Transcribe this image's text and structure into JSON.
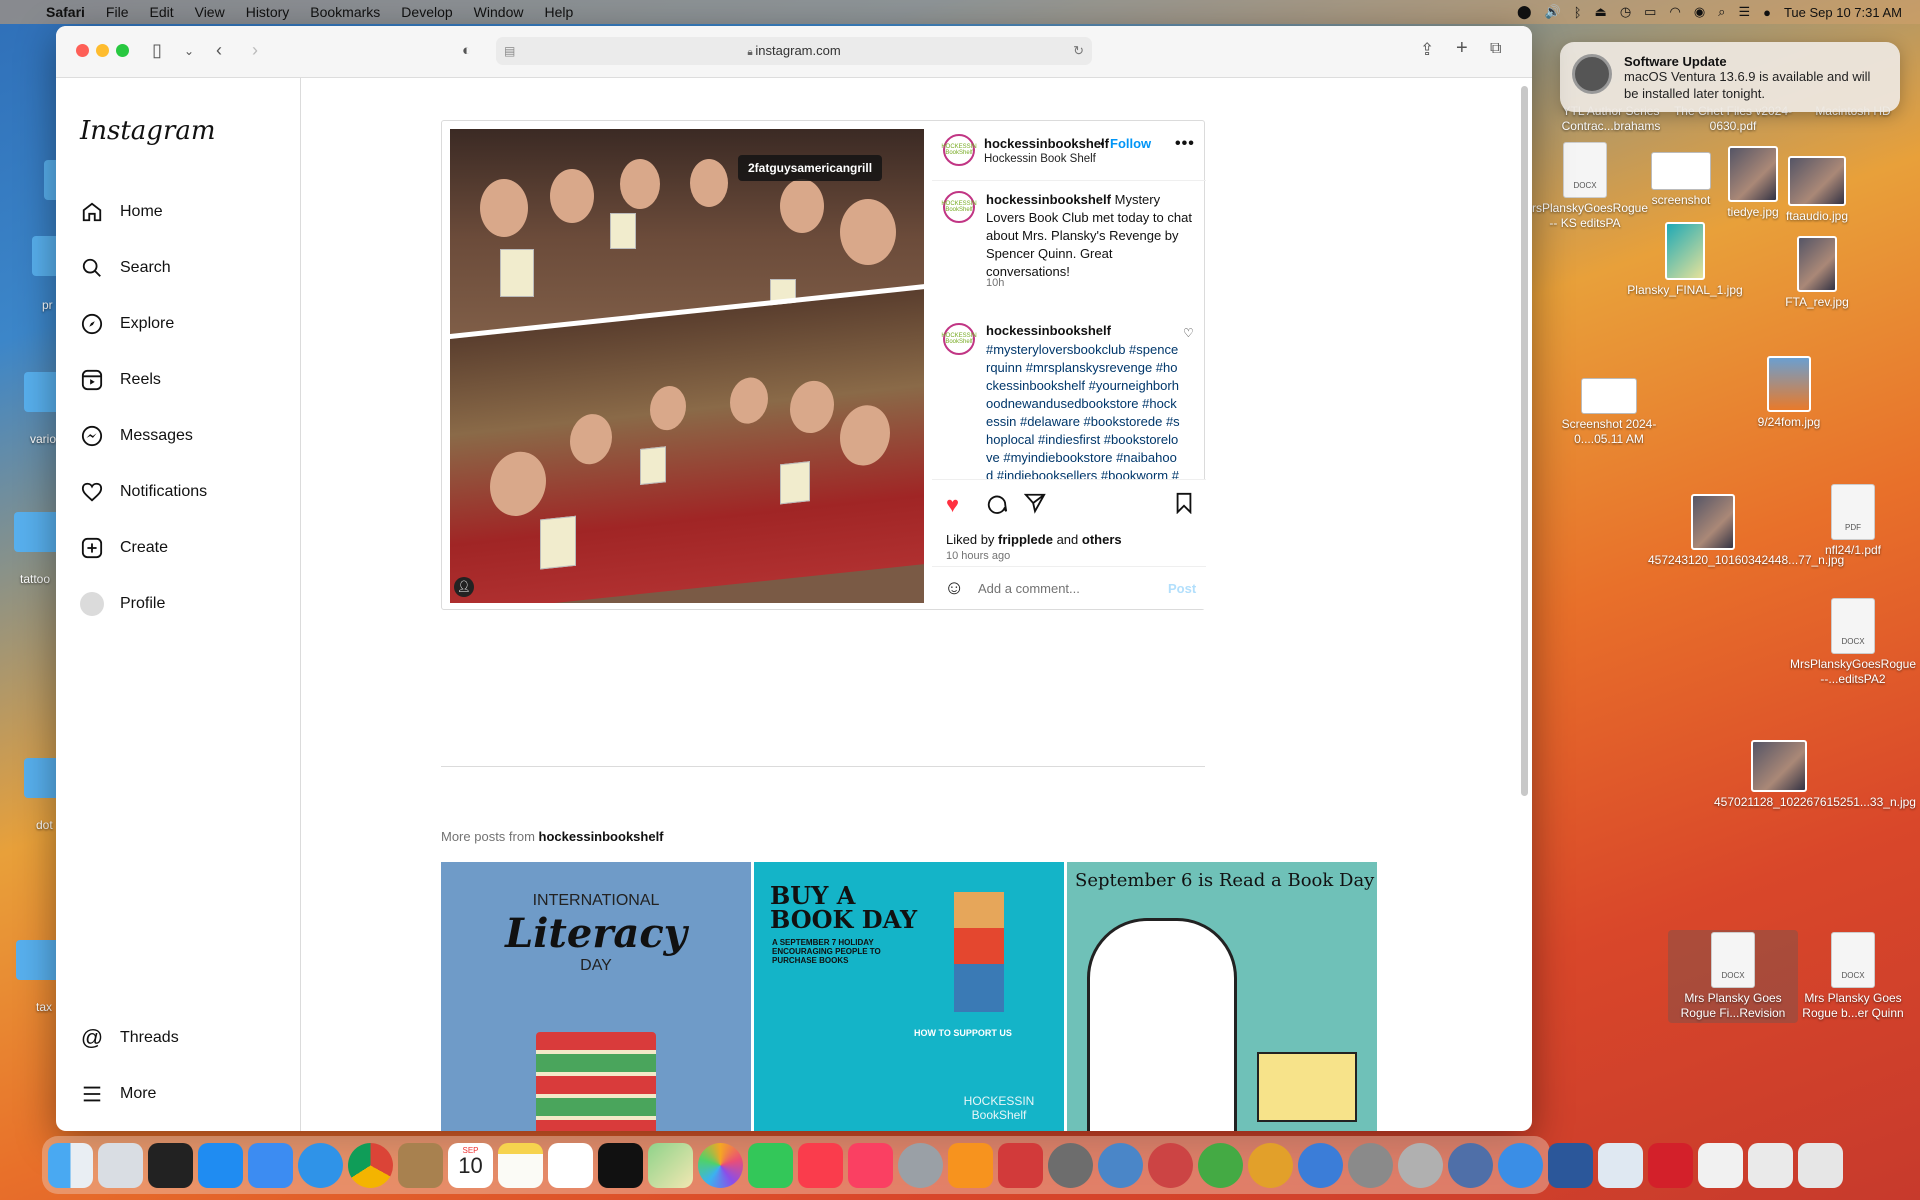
{
  "menubar": {
    "app": "Safari",
    "items": [
      "File",
      "Edit",
      "View",
      "History",
      "Bookmarks",
      "Develop",
      "Window",
      "Help"
    ],
    "datetime": "Tue Sep 10  7:31 AM"
  },
  "notification": {
    "title": "Software Update",
    "body": "macOS Ventura 13.6.9 is available and will be installed later tonight."
  },
  "desktop": {
    "left_labels": [
      "pr",
      "vario",
      "tattoo",
      "dot",
      "tax"
    ],
    "icons": [
      {
        "label": "YTL Author Series Contrac...brahams",
        "kind": "doc"
      },
      {
        "label": "The Chet Files v2024-0630.pdf",
        "kind": "doc"
      },
      {
        "label": "Macintosh HD",
        "kind": "doc"
      },
      {
        "label": "MrsPlanskyGoesRogue -- KS editsPA",
        "kind": "docx",
        "badge": "DOCX"
      },
      {
        "label": "screenshot",
        "kind": "shot"
      },
      {
        "label": "tiedye.jpg",
        "kind": "img"
      },
      {
        "label": "ftaaudio.jpg",
        "kind": "img"
      },
      {
        "label": "Plansky_FINAL_1.jpg",
        "kind": "img"
      },
      {
        "label": "FTA_rev.jpg",
        "kind": "img"
      },
      {
        "label": "Screenshot 2024-0....05.11 AM",
        "kind": "shot"
      },
      {
        "label": "9/24fom.jpg",
        "kind": "img"
      },
      {
        "label": "457243120_10160342448...77_n.jpg",
        "kind": "img"
      },
      {
        "label": "nfl24/1.pdf",
        "kind": "pdf",
        "badge": "PDF"
      },
      {
        "label": "MrsPlanskyGoesRogue --...editsPA2",
        "kind": "docx",
        "badge": "DOCX"
      },
      {
        "label": "457021128_102267615251...33_n.jpg",
        "kind": "img"
      },
      {
        "label": "Mrs Plansky Goes Rogue Fi...Revision",
        "kind": "docx",
        "badge": "DOCX"
      },
      {
        "label": "Mrs Plansky Goes Rogue b...er Quinn",
        "kind": "docx",
        "badge": "DOCX"
      }
    ]
  },
  "browser": {
    "url": "instagram.com"
  },
  "sidebar": {
    "logo": "Instagram",
    "items": [
      {
        "label": "Home",
        "icon": "home-icon"
      },
      {
        "label": "Search",
        "icon": "search-icon"
      },
      {
        "label": "Explore",
        "icon": "compass-icon"
      },
      {
        "label": "Reels",
        "icon": "reels-icon"
      },
      {
        "label": "Messages",
        "icon": "messenger-icon"
      },
      {
        "label": "Notifications",
        "icon": "heart-icon"
      },
      {
        "label": "Create",
        "icon": "plus-square-icon"
      },
      {
        "label": "Profile",
        "icon": "avatar-icon"
      }
    ],
    "bottom": [
      {
        "label": "Threads",
        "icon": "threads-icon"
      },
      {
        "label": "More",
        "icon": "menu-icon"
      }
    ]
  },
  "post": {
    "photo_tag": "2fatguysamericangrill",
    "username": "hockessinbookshelf",
    "follow": "Follow",
    "subtitle": "Hockessin Book Shelf",
    "avatar_text": "HOCKESSIN BookShelf",
    "caption": "Mystery Lovers Book Club met today to chat about Mrs. Plansky's Revenge by Spencer Quinn. Great conversations!",
    "caption_time": "10h",
    "comment_user": "hockessinbookshelf",
    "hashtags": "#mysteryloversbookclub #spencerquinn #mrsplanskysrevenge #hockessinbookshelf #yourneighborhoodnewandusedbookstore #hockessin #delaware #bookstorede #shoplocal #indiesfirst #bookstorelove #myindiebookstore #naibahood #indiebooksellers #bookworm #booknerd #bookaddict #supportlocalbookstores",
    "liked_by_prefix": "Liked by ",
    "liked_by_user": "fripplede",
    "liked_by_mid": " and ",
    "liked_by_others": "others",
    "time_ago": "10 hours ago",
    "comment_placeholder": "Add a comment...",
    "post_button": "Post"
  },
  "more_posts": {
    "prefix": "More posts from ",
    "user": "hockessinbookshelf",
    "tiles": [
      {
        "l1": "INTERNATIONAL",
        "l2": "Literacy",
        "l3": "DAY",
        "bg": "#6f9bc8"
      },
      {
        "l1": "BUY A BOOK DAY",
        "l2": "A SEPTEMBER 7 HOLIDAY ENCOURAGING PEOPLE TO PURCHASE BOOKS",
        "l3": "HOW TO SUPPORT US",
        "l4": "HOCKESSIN BookShelf",
        "bg": "#14b4c8"
      },
      {
        "l1": "September 6 is Read a Book Day",
        "bg": "#6fc1b8"
      }
    ]
  },
  "dock_calendar": {
    "month": "SEP",
    "day": "10"
  },
  "colors": {
    "accent": "#0095f6",
    "like": "#ff3040"
  }
}
